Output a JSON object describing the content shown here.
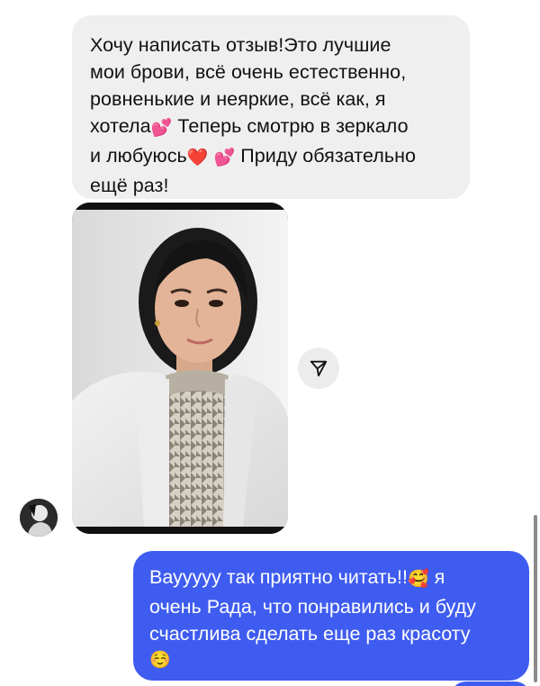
{
  "incoming_message": {
    "lines": [
      "Хочу написать отзыв!Это лучшие",
      "мои брови, всё очень естественно,",
      "ровненькие и неяркие, всё как, я"
    ],
    "line4_a": "хотела",
    "line4_b": " Теперь смотрю в зеркало",
    "line5_a": "и любуюсь",
    "line5_b": " Приду обязательно",
    "line6": "ещё раз!",
    "emoji_hearts": "💕",
    "emoji_red_heart": "❤️"
  },
  "outgoing_message": {
    "line1_a": "Ваууууу так приятно читать!!",
    "line1_b": " я",
    "line2": "очень Рада, что понравились и буду",
    "line3": "счастлива сделать еще раз красоту",
    "emoji_smiling_hearts": "🥰",
    "emoji_smile": "☺️"
  },
  "icons": {
    "share": "paper-plane-icon",
    "avatar": "contact-avatar"
  },
  "colors": {
    "incoming_bubble": "#efefef",
    "outgoing_bubble": "#3f5cf0",
    "share_button": "#ececec"
  }
}
